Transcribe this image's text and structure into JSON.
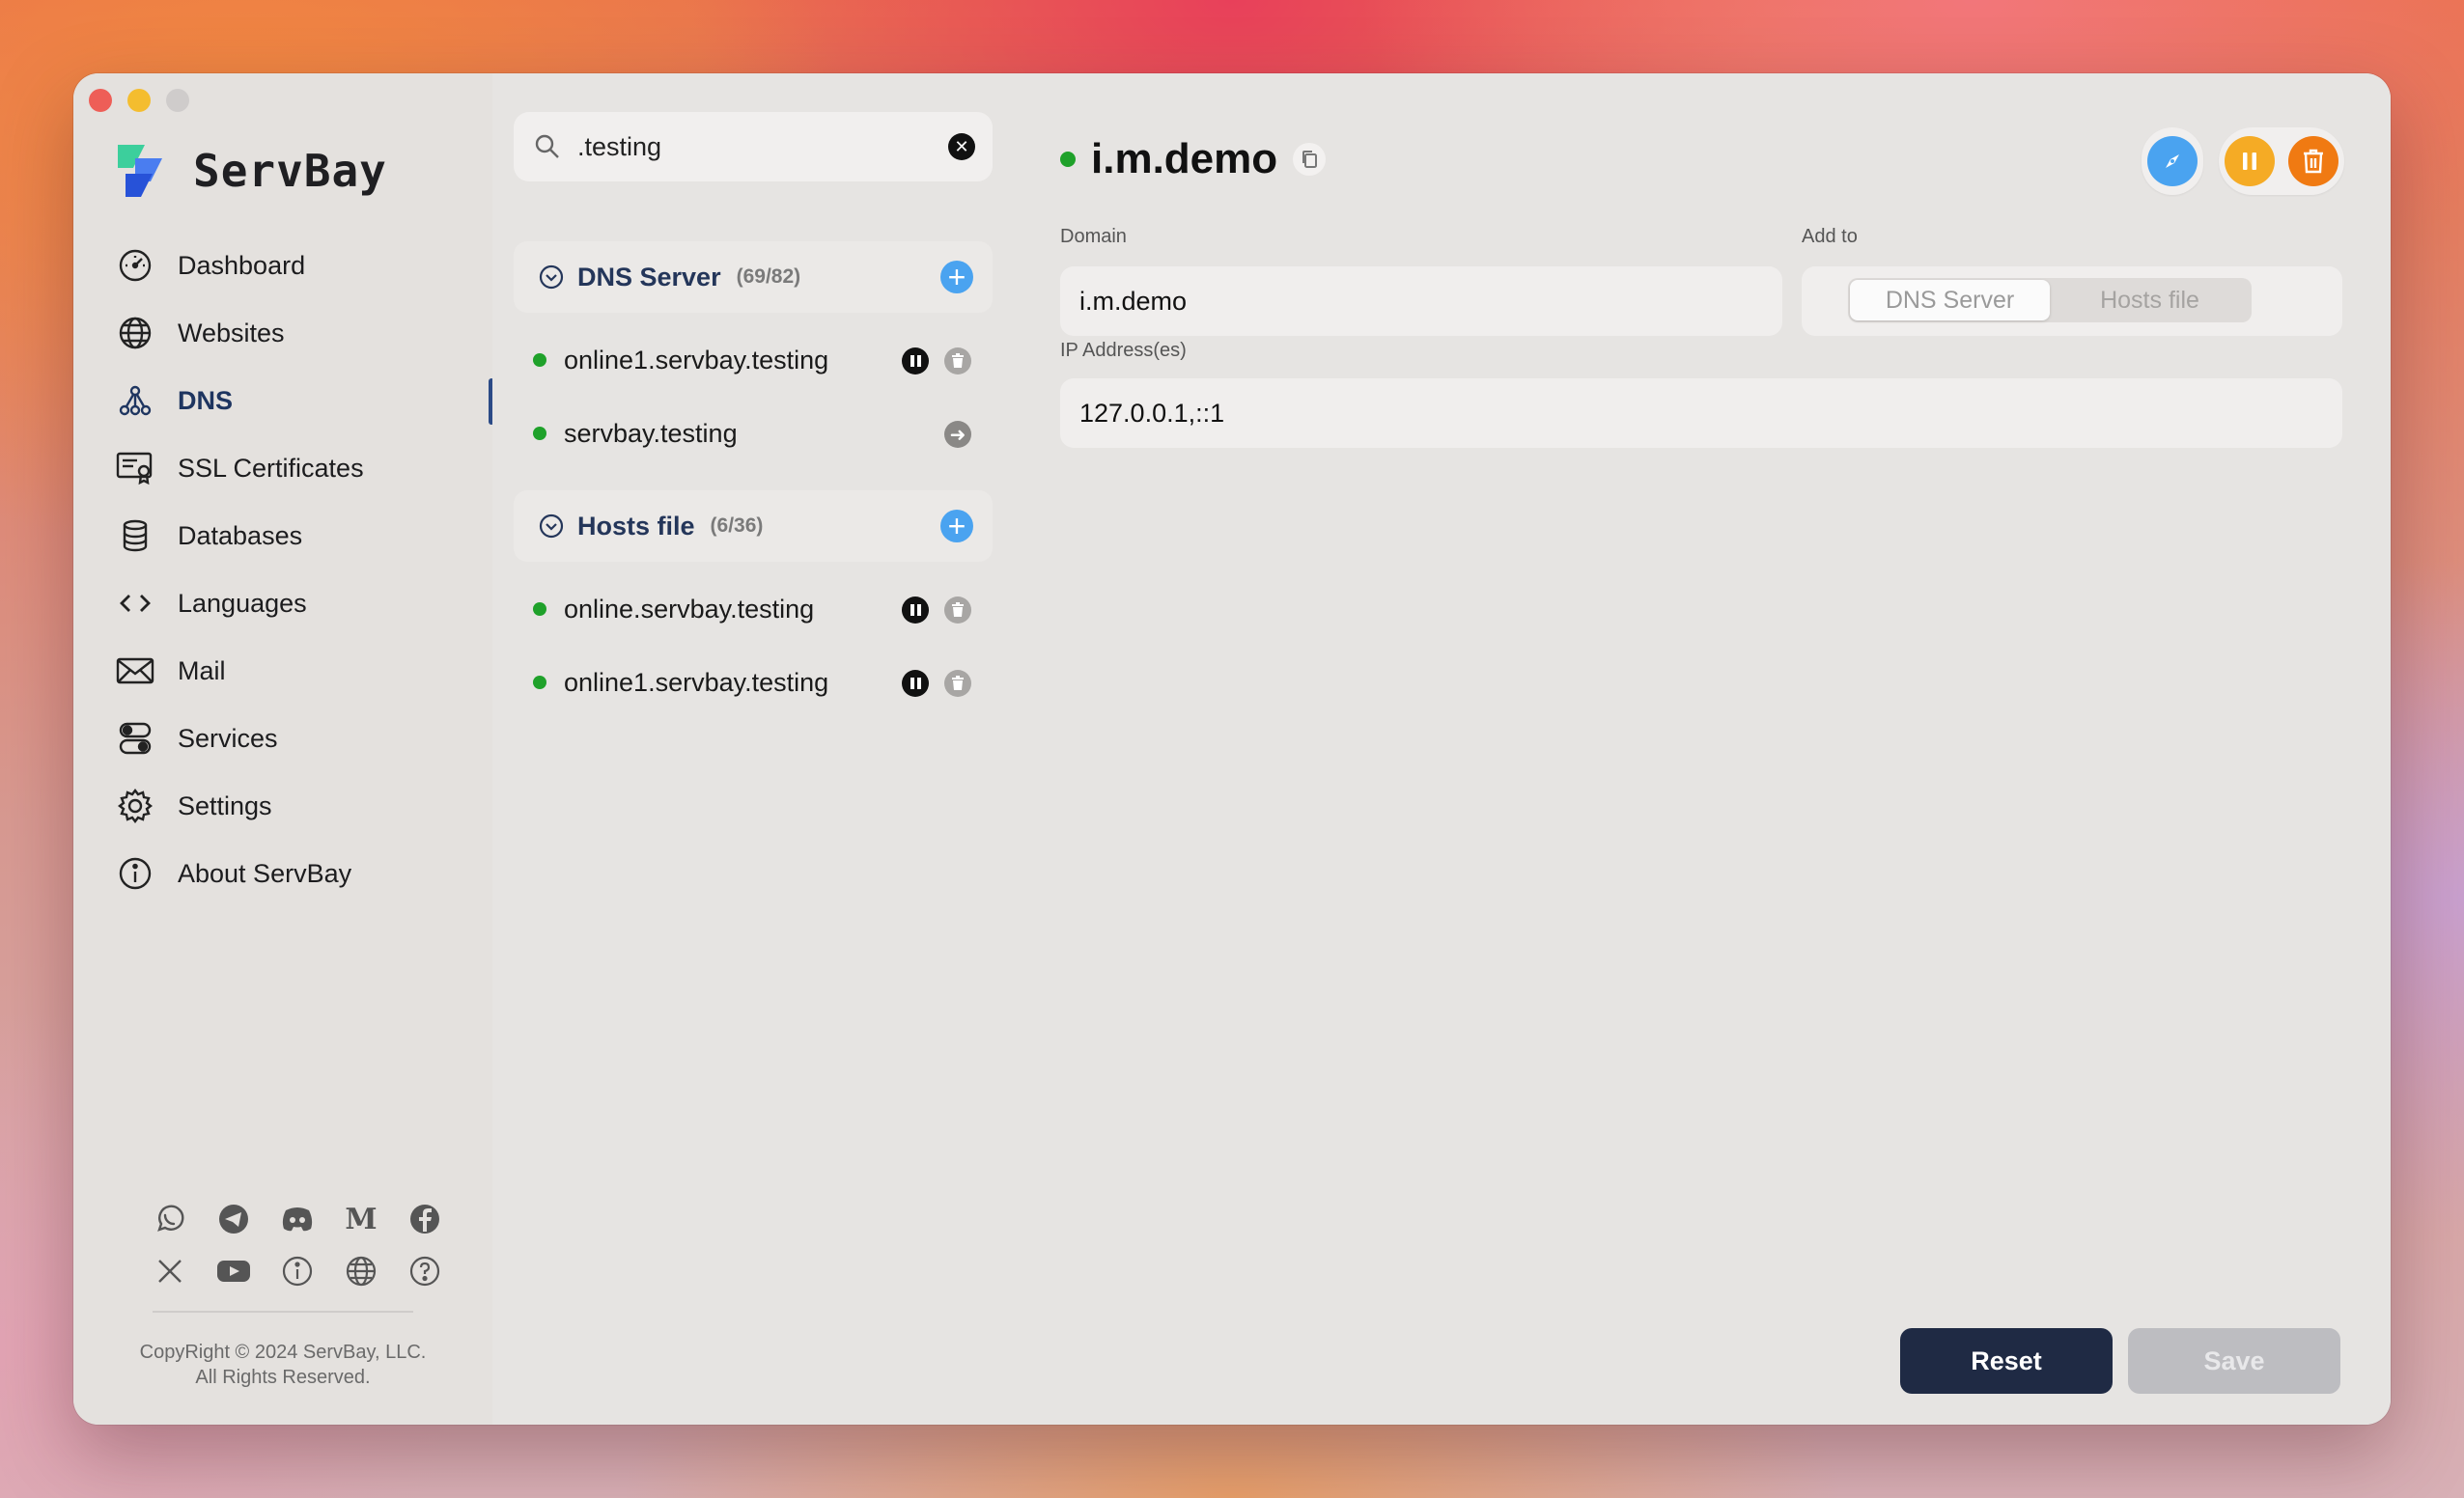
{
  "app": {
    "name": "ServBay"
  },
  "sidebar": {
    "items": [
      {
        "label": "Dashboard",
        "icon": "dashboard-gauge-icon"
      },
      {
        "label": "Websites",
        "icon": "globe-icon"
      },
      {
        "label": "DNS",
        "icon": "dns-network-icon",
        "active": true
      },
      {
        "label": "SSL Certificates",
        "icon": "certificate-icon"
      },
      {
        "label": "Databases",
        "icon": "database-icon"
      },
      {
        "label": "Languages",
        "icon": "code-brackets-icon"
      },
      {
        "label": "Mail",
        "icon": "mail-icon"
      },
      {
        "label": "Services",
        "icon": "toggle-switch-icon"
      },
      {
        "label": "Settings",
        "icon": "gear-icon"
      },
      {
        "label": "About ServBay",
        "icon": "info-icon"
      }
    ],
    "social_row1": [
      "whatsapp-icon",
      "telegram-icon",
      "discord-icon",
      "medium-icon",
      "facebook-icon"
    ],
    "social_row2": [
      "x-icon",
      "youtube-icon",
      "info-icon",
      "globe-icon",
      "help-icon"
    ],
    "medium_glyph": "M",
    "copyright_line1": "CopyRight © 2024 ServBay, LLC.",
    "copyright_line2": "All Rights Reserved."
  },
  "list": {
    "search_value": ".testing",
    "groups": [
      {
        "title": "DNS Server",
        "count": "(69/82)",
        "rows": [
          {
            "label": "online1.servbay.testing",
            "actions": [
              "pause",
              "trash"
            ]
          },
          {
            "label": "servbay.testing",
            "actions": [
              "arrow"
            ]
          }
        ]
      },
      {
        "title": "Hosts file",
        "count": "(6/36)",
        "rows": [
          {
            "label": "online.servbay.testing",
            "actions": [
              "pause",
              "trash"
            ]
          },
          {
            "label": "online1.servbay.testing",
            "actions": [
              "pause",
              "trash"
            ]
          }
        ]
      }
    ]
  },
  "detail": {
    "title": "i.m.demo",
    "domain_label": "Domain",
    "domain_value": "i.m.demo",
    "add_to_label": "Add to",
    "add_to_options": [
      "DNS Server",
      "Hosts file"
    ],
    "add_to_selected": "DNS Server",
    "ip_label": "IP Address(es)",
    "ip_value": "127.0.0.1,::1",
    "reset_label": "Reset",
    "save_label": "Save"
  },
  "colors": {
    "accent_blue": "#4aa3f0",
    "status_green": "#1fa12a",
    "pause_yellow": "#f5ab25",
    "delete_orange": "#f07a12",
    "reset_dark": "#1f2a44"
  }
}
